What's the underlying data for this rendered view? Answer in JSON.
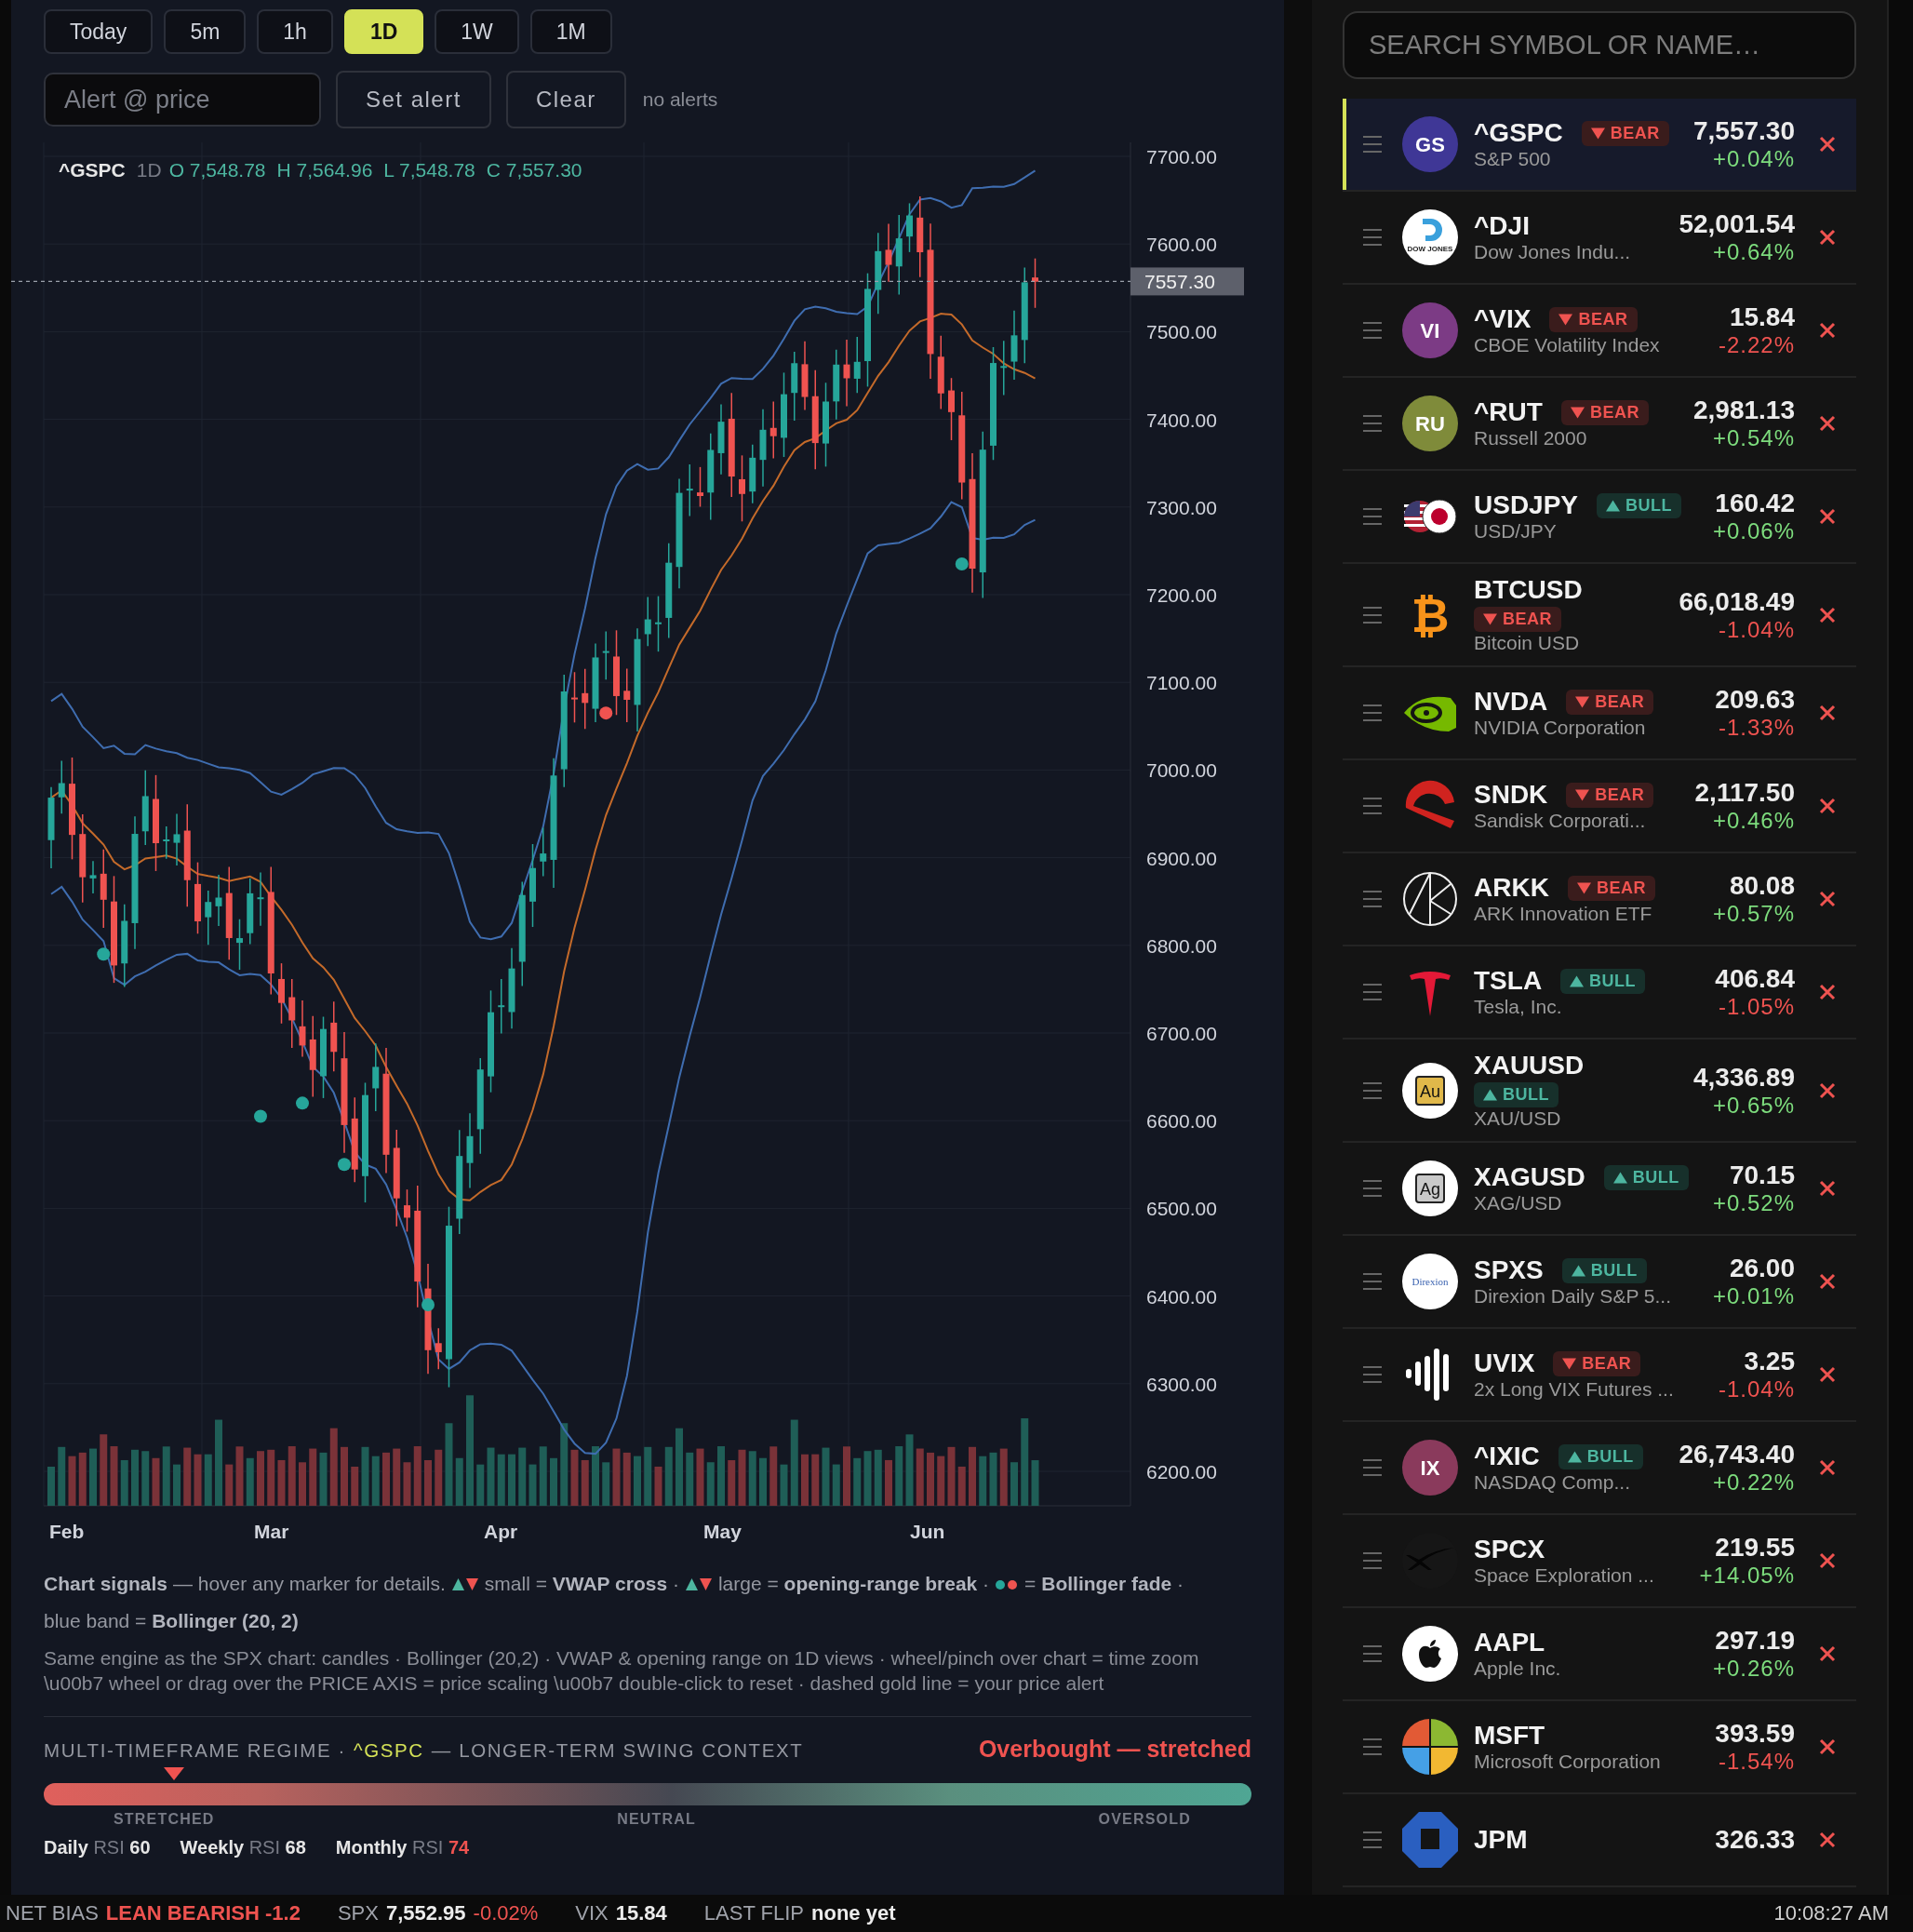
{
  "timeframes": [
    {
      "label": "Today",
      "selected": false
    },
    {
      "label": "5m",
      "selected": false
    },
    {
      "label": "1h",
      "selected": false
    },
    {
      "label": "1D",
      "selected": true
    },
    {
      "label": "1W",
      "selected": false
    },
    {
      "label": "1M",
      "selected": false
    }
  ],
  "alert": {
    "placeholder": "Alert @ price",
    "buttons": [
      "Set alert",
      "Clear"
    ],
    "status": "no alerts"
  },
  "chart": {
    "header": {
      "symbol": "^GSPC",
      "interval": "1D",
      "values": [
        "O 7,548.78",
        "H 7,564.96",
        "L 7,548.78",
        "C 7,557.30"
      ]
    },
    "price_axis": [
      "7700.00",
      "7600.00",
      "7500.00",
      "7400.00",
      "7300.00",
      "7200.00",
      "7100.00",
      "7000.00",
      "6900.00",
      "6800.00",
      "6700.00",
      "6600.00",
      "6500.00",
      "6400.00",
      "6300.00",
      "6200.00"
    ],
    "last_price": "7557.30",
    "months": [
      "Feb",
      "Mar",
      "Apr",
      "May",
      "Jun"
    ]
  },
  "legend": [
    "**Chart signals** — hover any marker for details.",
    "small = **VWAP cross** ·",
    "large = **opening-range break** ·",
    "= **Bollinger fade** ·",
    "blue band = **Bollinger (20, 2)**"
  ],
  "note": "Same engine as the SPX chart: candles · Bollinger (20,2) · VWAP & opening range on 1D views · wheel/pinch over chart = time zoom \\u00b7 wheel or drag over the PRICE AXIS = price scaling \\u00b7 double-click to reset · dashed gold line = your price alert",
  "regime": {
    "title": "MULTI-TIMEFRAME REGIME ·",
    "symbol": "^GSPC",
    "subtitle": "— LONGER-TERM SWING CONTEXT",
    "verdict": "Overbought — stretched",
    "level": 0.108,
    "scale": [
      "STRETCHED",
      "NEUTRAL",
      "OVERSOLD"
    ],
    "rsi": [
      {
        "period": "Daily",
        "label": "RSI",
        "value": "60",
        "overbought": false
      },
      {
        "period": "Weekly",
        "label": "RSI",
        "value": "68",
        "overbought": false
      },
      {
        "period": "Monthly",
        "label": "RSI",
        "value": "74",
        "overbought": true
      }
    ]
  },
  "watchlist": {
    "search": {
      "placeholder": "SEARCH SYMBOL OR NAME…"
    },
    "items": [
      {
        "symbol": "^GSPC",
        "badge": {
          "bullish": false,
          "label": "BEAR"
        },
        "name": "S&P 500",
        "price": "7,557.30",
        "change": "+0.04%",
        "falling": false,
        "selected": true,
        "logo": {
          "kind": "initials",
          "text": "GS",
          "color": "#3f3796"
        }
      },
      {
        "symbol": "^DJI",
        "name": "Dow Jones Indu...",
        "price": "52,001.54",
        "change": "+0.64%",
        "falling": false,
        "selected": false,
        "logo": {
          "kind": "dj",
          "text": "DOW JONES"
        }
      },
      {
        "symbol": "^VIX",
        "badge": {
          "bullish": false,
          "label": "BEAR"
        },
        "name": "CBOE Volatility Index",
        "price": "15.84",
        "change": "-2.22%",
        "falling": true,
        "selected": false,
        "logo": {
          "kind": "initials",
          "text": "VI",
          "color": "#7c3b85"
        }
      },
      {
        "symbol": "^RUT",
        "badge": {
          "bullish": false,
          "label": "BEAR"
        },
        "name": "Russell 2000",
        "price": "2,981.13",
        "change": "+0.54%",
        "falling": false,
        "selected": false,
        "logo": {
          "kind": "initials",
          "text": "RU",
          "color": "#7f8b3a"
        }
      },
      {
        "symbol": "USDJPY",
        "badge": {
          "bullish": true,
          "label": "BULL"
        },
        "name": "USD/JPY",
        "price": "160.42",
        "change": "+0.06%",
        "falling": false,
        "selected": false,
        "logo": {
          "kind": "flags"
        }
      },
      {
        "symbol": "BTCUSD",
        "badge": {
          "bullish": false,
          "label": "BEAR"
        },
        "name": "Bitcoin USD",
        "price": "66,018.49",
        "change": "-1.04%",
        "falling": true,
        "selected": false,
        "logo": {
          "kind": "glyph",
          "text": "₿"
        }
      },
      {
        "symbol": "NVDA",
        "badge": {
          "bullish": false,
          "label": "BEAR"
        },
        "name": "NVIDIA Corporation",
        "price": "209.63",
        "change": "-1.33%",
        "falling": true,
        "selected": false,
        "logo": {
          "kind": "eye"
        }
      },
      {
        "symbol": "SNDK",
        "badge": {
          "bullish": false,
          "label": "BEAR"
        },
        "name": "Sandisk Corporati...",
        "price": "2,117.50",
        "change": "+0.46%",
        "falling": false,
        "selected": false,
        "logo": {
          "kind": "swoosh"
        }
      },
      {
        "symbol": "ARKK",
        "badge": {
          "bullish": false,
          "label": "BEAR"
        },
        "name": "ARK Innovation ETF",
        "price": "80.08",
        "change": "+0.57%",
        "falling": false,
        "selected": false,
        "logo": {
          "kind": "lines"
        }
      },
      {
        "symbol": "TSLA",
        "badge": {
          "bullish": true,
          "label": "BULL"
        },
        "name": "Tesla, Inc.",
        "price": "406.84",
        "change": "-1.05%",
        "falling": true,
        "selected": false,
        "logo": {
          "kind": "tshape"
        }
      },
      {
        "symbol": "XAUUSD",
        "badge": {
          "bullish": true,
          "label": "BULL"
        },
        "name": "XAU/USD",
        "price": "4,336.89",
        "change": "+0.65%",
        "falling": false,
        "selected": false,
        "logo": {
          "kind": "element",
          "text": "Au",
          "color": "#e0b84a"
        }
      },
      {
        "symbol": "XAGUSD",
        "badge": {
          "bullish": true,
          "label": "BULL"
        },
        "name": "XAG/USD",
        "price": "70.15",
        "change": "+0.52%",
        "falling": false,
        "selected": false,
        "logo": {
          "kind": "element",
          "text": "Ag",
          "color": "#c9c9c9"
        }
      },
      {
        "symbol": "SPXS",
        "badge": {
          "bullish": true,
          "label": "BULL"
        },
        "name": "Direxion Daily S&P 5...",
        "price": "26.00",
        "change": "+0.01%",
        "falling": false,
        "selected": false,
        "logo": {
          "kind": "word",
          "text": "Direxion"
        }
      },
      {
        "symbol": "UVIX",
        "badge": {
          "bullish": false,
          "label": "BEAR"
        },
        "name": "2x Long VIX Futures ...",
        "price": "3.25",
        "change": "-1.04%",
        "falling": true,
        "selected": false,
        "logo": {
          "kind": "bars"
        }
      },
      {
        "symbol": "^IXIC",
        "badge": {
          "bullish": true,
          "label": "BULL"
        },
        "name": "NASDAQ Comp...",
        "price": "26,743.40",
        "change": "+0.22%",
        "falling": false,
        "selected": false,
        "logo": {
          "kind": "initials",
          "text": "IX",
          "color": "#8a3a5c"
        }
      },
      {
        "symbol": "SPCX",
        "name": "Space Exploration ...",
        "price": "219.55",
        "change": "+14.05%",
        "falling": false,
        "selected": false,
        "logo": {
          "kind": "cross"
        }
      },
      {
        "symbol": "AAPL",
        "name": "Apple Inc.",
        "price": "297.19",
        "change": "+0.26%",
        "falling": false,
        "selected": false,
        "logo": {
          "kind": "apple"
        }
      },
      {
        "symbol": "MSFT",
        "name": "Microsoft Corporation",
        "price": "393.59",
        "change": "-1.54%",
        "falling": true,
        "selected": false,
        "logo": {
          "kind": "quads"
        }
      },
      {
        "symbol": "JPM",
        "price": "326.33",
        "selected": false,
        "logo": {
          "kind": "octagon"
        }
      }
    ]
  },
  "status_bar": {
    "items": [
      {
        "label": "NET BIAS",
        "value": "LEAN BEARISH -1.2",
        "negative": true
      },
      {
        "label": "SPX",
        "value": "7,552.95",
        "negative": false,
        "change": "-0.02%",
        "falling": true
      },
      {
        "label": "VIX",
        "value": "15.84",
        "negative": false
      },
      {
        "label": "LAST FLIP",
        "value": "none yet",
        "negative": false
      }
    ],
    "clock": "10:08:27 AM"
  }
}
